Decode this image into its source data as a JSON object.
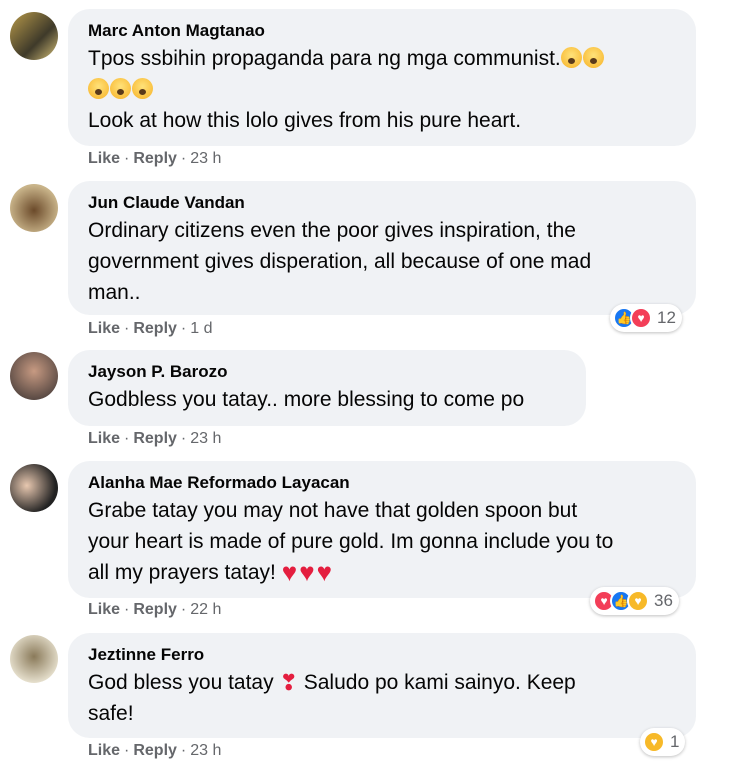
{
  "comments": [
    {
      "author": "Marc Anton Magtanao",
      "line1": "Tpos ssbihin propaganda para ng mga communist.",
      "line3": "Look at how this lolo gives from his pure heart.",
      "like": "Like",
      "reply": "Reply",
      "time": "23 h",
      "avatar_icon": "avatar-photo"
    },
    {
      "author": "Jun Claude Vandan",
      "line1": "Ordinary citizens even the poor gives inspiration, the",
      "line2": "government gives disperation, all because of one mad",
      "line3": "man..",
      "like": "Like",
      "reply": "Reply",
      "time": "1 d",
      "reactions": {
        "icons": [
          "like-reaction-icon",
          "love-reaction-icon"
        ],
        "count": "12"
      }
    },
    {
      "author": "Jayson P. Barozo",
      "line1": "Godbless you tatay.. more blessing to come po",
      "like": "Like",
      "reply": "Reply",
      "time": "23 h"
    },
    {
      "author": "Alanha Mae Reformado Layacan",
      "line1": "Grabe tatay you may not have that golden spoon but",
      "line2": "your heart is made of pure gold. Im gonna include you to",
      "line3": "all my prayers tatay!",
      "like": "Like",
      "reply": "Reply",
      "time": "22 h",
      "reactions": {
        "icons": [
          "love-reaction-icon",
          "like-reaction-icon",
          "care-reaction-icon"
        ],
        "count": "36"
      }
    },
    {
      "author": "Jeztinne Ferro",
      "line1a": "God bless you tatay",
      "line1b": "Saludo po kami sainyo. Keep",
      "line2": "safe!",
      "like": "Like",
      "reply": "Reply",
      "time": "23 h",
      "reactions": {
        "icons": [
          "care-reaction-icon"
        ],
        "count": "1"
      }
    }
  ],
  "colors": {
    "bubble": "#f0f2f5",
    "meta": "#65676b",
    "like": "#1877f2",
    "love": "#f33e58",
    "care": "#f7b928"
  }
}
